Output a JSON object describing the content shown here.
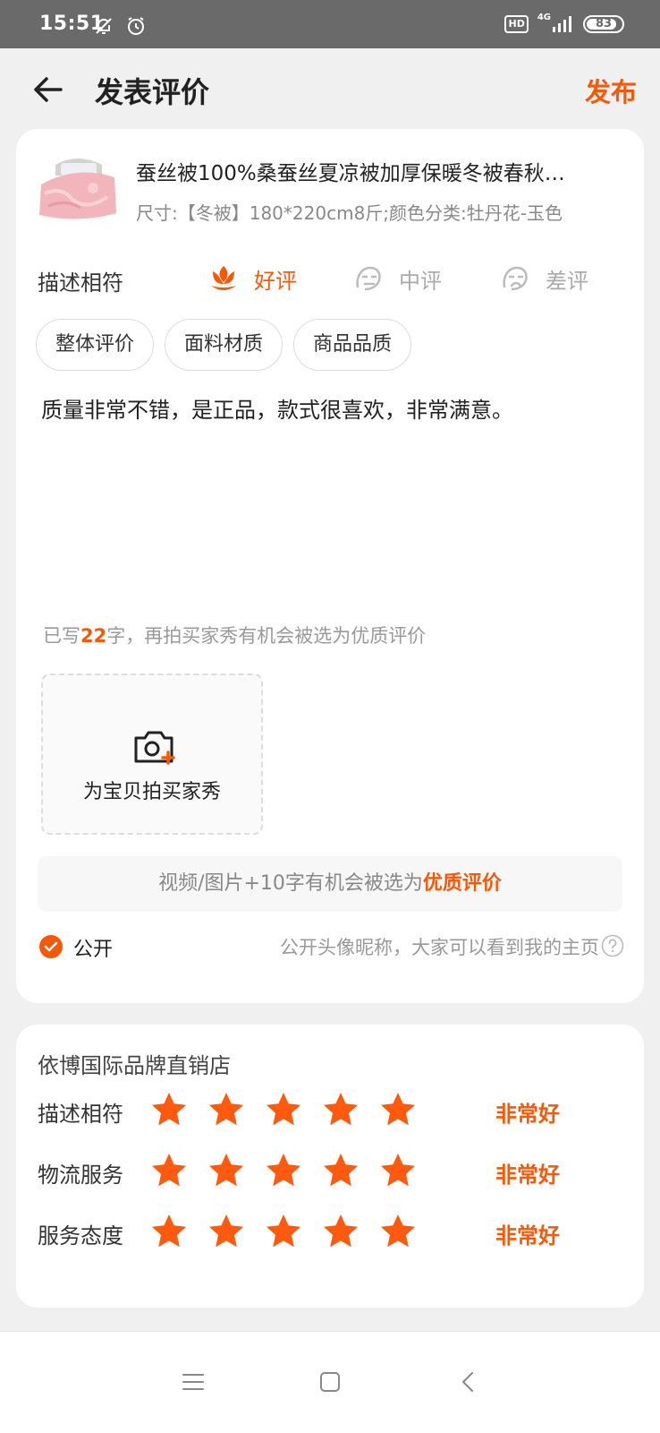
{
  "status_bar": {
    "time": "15:51",
    "network": "4G",
    "hd": "HD",
    "battery": "83",
    "battery_level": 0.83,
    "icons": [
      "bell-off-icon",
      "alarm-icon",
      "signal-icon"
    ]
  },
  "nav": {
    "title": "发表评价",
    "publish_label": "发布",
    "back_icon": "arrow-left-icon"
  },
  "product": {
    "title": "蚕丝被100%桑蚕丝夏凉被加厚保暖冬被春秋…",
    "spec": "尺寸:【冬被】180*220cm8斤;颜色分类:牡丹花-玉色"
  },
  "rating": {
    "label": "描述相符",
    "options": [
      {
        "label": "好评",
        "selected": true,
        "icon": "flower-icon"
      },
      {
        "label": "中评",
        "selected": false,
        "icon": "neutral-face-icon"
      },
      {
        "label": "差评",
        "selected": false,
        "icon": "sad-face-icon"
      }
    ]
  },
  "tags": [
    "整体评价",
    "面料材质",
    "商品品质"
  ],
  "review": {
    "text": "质量非常不错，是正品，款式很喜欢，非常满意。",
    "count_prefix": "已写",
    "count": "22",
    "count_suffix": "字，再拍买家秀有机会被选为优质评价"
  },
  "upload": {
    "label": "为宝贝拍买家秀",
    "icon": "camera-add-icon"
  },
  "tip": {
    "prefix": "视频/图片+10字有机会被选为",
    "highlight": "优质评价"
  },
  "public": {
    "label": "公开",
    "checked": true,
    "description": "公开头像昵称，大家可以看到我的主页"
  },
  "store": {
    "name": "依博国际品牌直销店",
    "ratings": [
      {
        "label": "描述相符",
        "stars": 5,
        "value": "非常好"
      },
      {
        "label": "物流服务",
        "stars": 5,
        "value": "非常好"
      },
      {
        "label": "服务态度",
        "stars": 5,
        "value": "非常好"
      }
    ]
  },
  "colors": {
    "accent": "#f25a0a",
    "muted": "#999999",
    "background": "#f0f0f0"
  }
}
